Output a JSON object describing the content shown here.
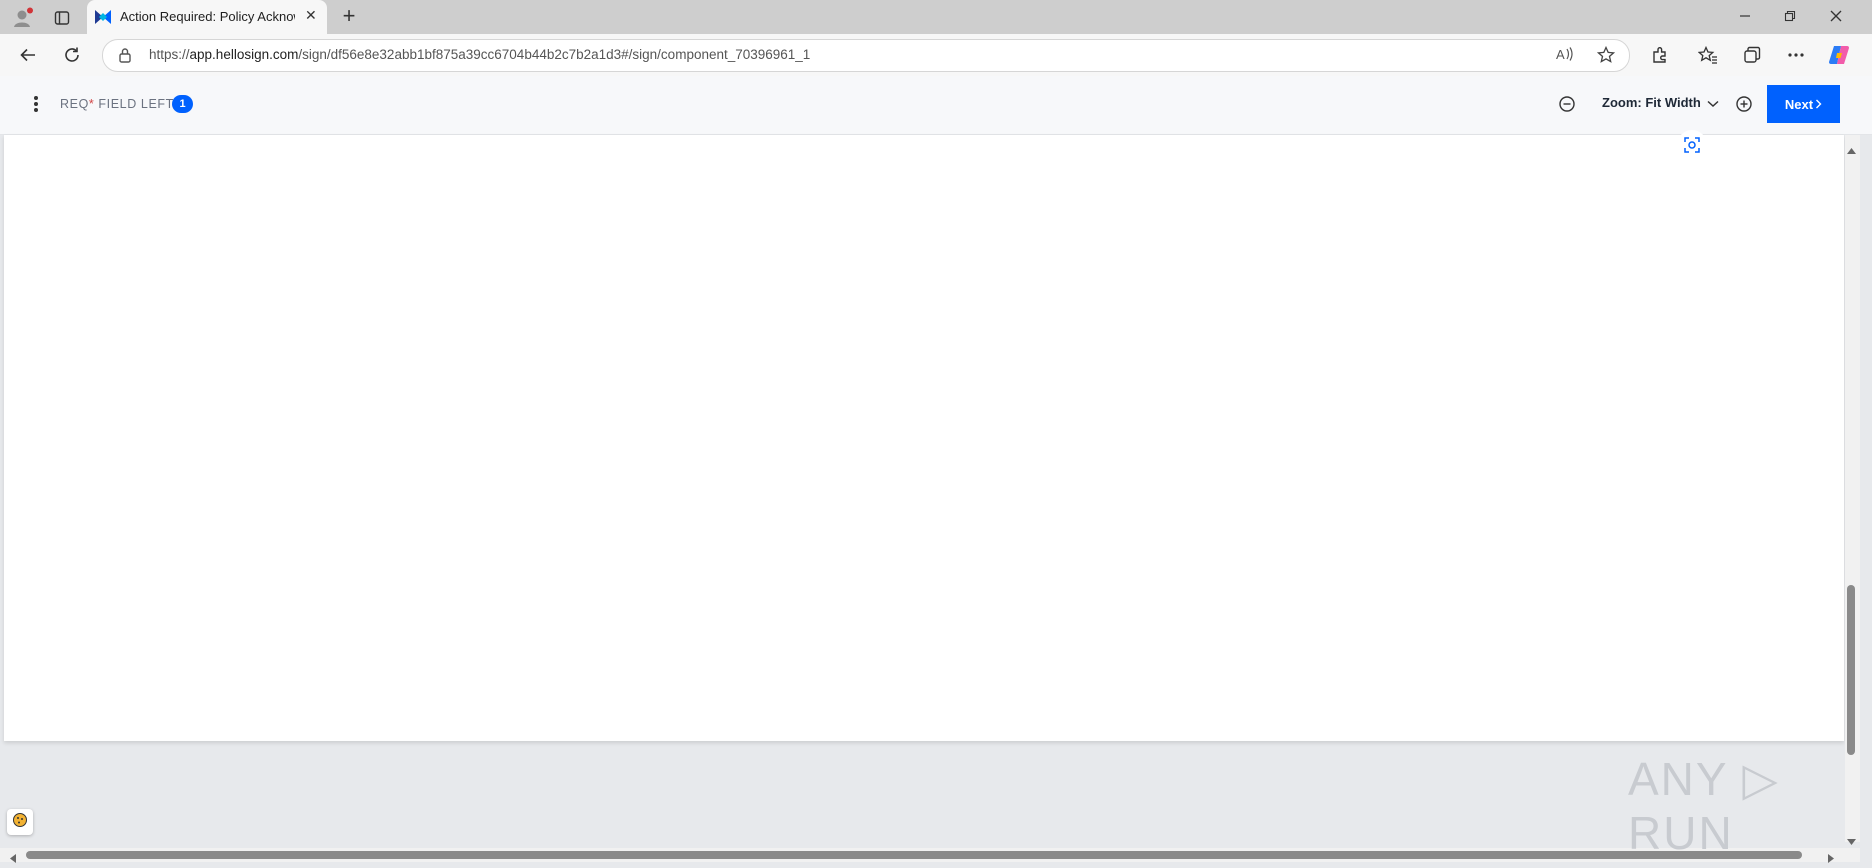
{
  "browser": {
    "tab_title": "Action Required: Policy Acknowle",
    "url_scheme": "https://",
    "url_host": "app.hellosign.com",
    "url_path": "/sign/df56e8e32abb1bf875a39cc6704b44b2c7b2a1d3#/sign/component_70396961_1",
    "new_tab_label": "+",
    "tab_close_label": "✕"
  },
  "header": {
    "req_prefix": "REQ",
    "req_star": "*",
    "req_suffix": " FIELD LEFT",
    "req_count": "1",
    "zoom_label": "Zoom: Fit Width",
    "next_label": "Next"
  },
  "watermark": {
    "text": "ANY ▷ RUN"
  },
  "colors": {
    "accent": "#0061fe",
    "required_star": "#d14343"
  },
  "icons": [
    "profile-icon",
    "tab-actions-icon",
    "hellosign-logo-icon",
    "back-icon",
    "refresh-icon",
    "lock-icon",
    "read-aloud-icon",
    "favorite-star-icon",
    "extensions-icon",
    "favorites-icon",
    "collections-icon",
    "more-icon",
    "copilot-icon",
    "kebab-menu-icon",
    "zoom-out-icon",
    "chevron-down-icon",
    "zoom-in-icon",
    "chevron-right-icon",
    "focus-icon",
    "cookie-icon"
  ]
}
